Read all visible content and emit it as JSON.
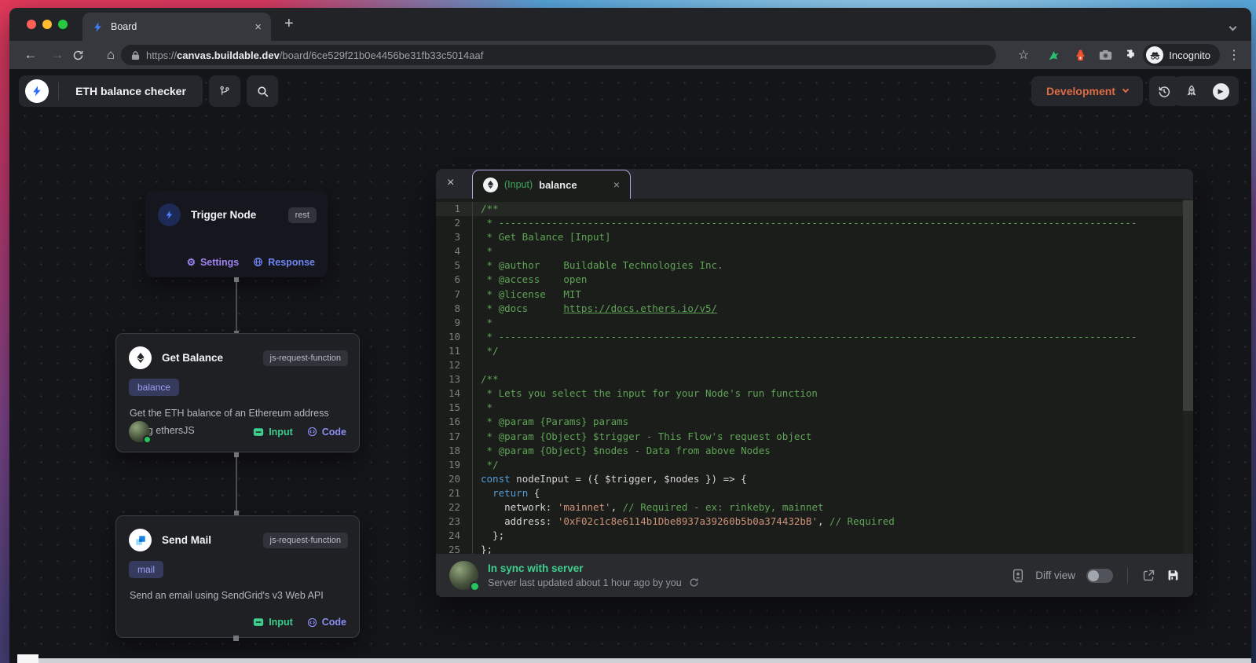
{
  "browser": {
    "tab": {
      "title": "Board"
    },
    "url": {
      "scheme": "https://",
      "host": "canvas.buildable.dev",
      "path": "/board/6ce529f21b0e4456be31fb33c5014aaf"
    },
    "incognito_label": "Incognito"
  },
  "icons": {
    "back": "←",
    "forward": "→",
    "home": "⌂",
    "star": "☆",
    "menu": "⋮",
    "close": "×",
    "new_tab": "+",
    "gear": "⚙",
    "play": "▶"
  },
  "app_header": {
    "board_title": "ETH balance checker",
    "env_button": "Development"
  },
  "canvas": {
    "trigger_node": {
      "title": "Trigger Node",
      "badge": "rest",
      "settings": "Settings",
      "response": "Response"
    },
    "get_balance_node": {
      "title": "Get Balance",
      "badge": "js-request-function",
      "tag": "balance",
      "desc1": "Get the ETH balance of an Ethereum address",
      "desc2": "using ethersJS",
      "input": "Input",
      "code": "Code"
    },
    "send_mail_node": {
      "title": "Send Mail",
      "badge": "js-request-function",
      "tag": "mail",
      "desc": "Send an email using SendGrid's v3 Web API",
      "input": "Input",
      "code": "Code"
    }
  },
  "editor": {
    "tab_kind": "(Input)",
    "tab_name": "balance",
    "footer": {
      "status": "In sync with server",
      "detail": "Server last updated about 1 hour ago by you",
      "diff_label": "Diff view"
    },
    "code_lines": [
      {
        "n": 1,
        "hl": true,
        "seg": [
          [
            "com",
            "/**"
          ]
        ]
      },
      {
        "n": 2,
        "seg": [
          [
            "com",
            " * ------------------------------------------------------------------------------------------------------------"
          ]
        ]
      },
      {
        "n": 3,
        "seg": [
          [
            "com",
            " * Get Balance [Input]"
          ]
        ]
      },
      {
        "n": 4,
        "seg": [
          [
            "com",
            " *"
          ]
        ]
      },
      {
        "n": 5,
        "seg": [
          [
            "com",
            " * @author    Buildable Technologies Inc."
          ]
        ]
      },
      {
        "n": 6,
        "seg": [
          [
            "com",
            " * @access    open"
          ]
        ]
      },
      {
        "n": 7,
        "seg": [
          [
            "com",
            " * @license   MIT"
          ]
        ]
      },
      {
        "n": 8,
        "seg": [
          [
            "com",
            " * @docs      "
          ],
          [
            "comlink",
            "https://docs.ethers.io/v5/"
          ]
        ]
      },
      {
        "n": 9,
        "seg": [
          [
            "com",
            " *"
          ]
        ]
      },
      {
        "n": 10,
        "seg": [
          [
            "com",
            " * ------------------------------------------------------------------------------------------------------------"
          ]
        ]
      },
      {
        "n": 11,
        "seg": [
          [
            "com",
            " */"
          ]
        ]
      },
      {
        "n": 12,
        "seg": []
      },
      {
        "n": 13,
        "seg": [
          [
            "com",
            "/**"
          ]
        ]
      },
      {
        "n": 14,
        "seg": [
          [
            "com",
            " * Lets you select the input for your Node's run function"
          ]
        ]
      },
      {
        "n": 15,
        "seg": [
          [
            "com",
            " *"
          ]
        ]
      },
      {
        "n": 16,
        "seg": [
          [
            "com",
            " * @param {Params} params"
          ]
        ]
      },
      {
        "n": 17,
        "seg": [
          [
            "com",
            " * @param {Object} $trigger - This Flow's request object"
          ]
        ]
      },
      {
        "n": 18,
        "seg": [
          [
            "com",
            " * @param {Object} $nodes - Data from above Nodes"
          ]
        ]
      },
      {
        "n": 19,
        "seg": [
          [
            "com",
            " */"
          ]
        ]
      },
      {
        "n": 20,
        "seg": [
          [
            "kw",
            "const"
          ],
          [
            "pl",
            " nodeInput = ({ $trigger, $nodes }) => {"
          ]
        ]
      },
      {
        "n": 21,
        "seg": [
          [
            "pl",
            "  "
          ],
          [
            "kw",
            "return"
          ],
          [
            "pl",
            " {"
          ]
        ]
      },
      {
        "n": 22,
        "seg": [
          [
            "pl",
            "    network: "
          ],
          [
            "str",
            "'mainnet'"
          ],
          [
            "pl",
            ", "
          ],
          [
            "com",
            "// Required - ex: rinkeby, mainnet"
          ]
        ]
      },
      {
        "n": 23,
        "seg": [
          [
            "pl",
            "    address: "
          ],
          [
            "str",
            "'0xF02c1c8e6114b1Dbe8937a39260b5b0a374432bB'"
          ],
          [
            "pl",
            ", "
          ],
          [
            "com",
            "// Required"
          ]
        ]
      },
      {
        "n": 24,
        "seg": [
          [
            "pl",
            "  };"
          ]
        ]
      },
      {
        "n": 25,
        "seg": [
          [
            "pl",
            "};"
          ]
        ]
      }
    ]
  },
  "colors": {
    "accent_orange": "#dd6b45",
    "status_green": "#3fcf8e",
    "input_green": "#3ecf8e",
    "code_link_purple": "#8b8df0",
    "settings_violet": "#9f85f2",
    "response_blue": "#6f86f2",
    "tag_bg": "#363a5d",
    "tag_text": "#99a2f2",
    "comment_green": "#5fa356",
    "keyword_blue": "#569cd6",
    "string_orange": "#ce9178"
  }
}
